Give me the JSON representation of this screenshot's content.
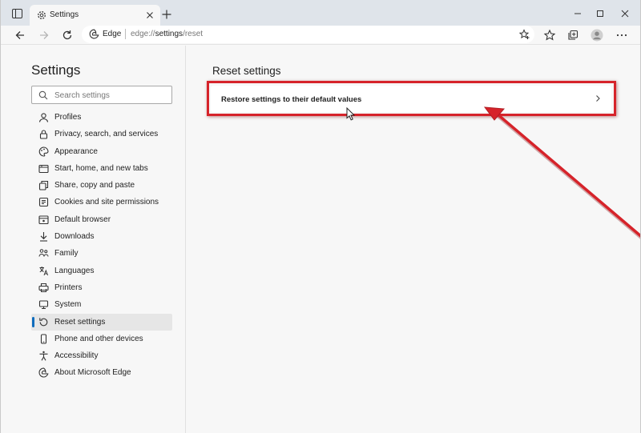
{
  "tab": {
    "title": "Settings"
  },
  "toolbar": {
    "site_label": "Edge",
    "url_prefix": "edge://",
    "url_host": "settings",
    "url_path": "/reset"
  },
  "sidebar": {
    "heading": "Settings",
    "search_placeholder": "Search settings",
    "items": [
      {
        "label": "Profiles",
        "icon": "profile-icon"
      },
      {
        "label": "Privacy, search, and services",
        "icon": "lock-icon"
      },
      {
        "label": "Appearance",
        "icon": "appearance-icon"
      },
      {
        "label": "Start, home, and new tabs",
        "icon": "home-tabs-icon"
      },
      {
        "label": "Share, copy and paste",
        "icon": "share-icon"
      },
      {
        "label": "Cookies and site permissions",
        "icon": "cookies-icon"
      },
      {
        "label": "Default browser",
        "icon": "browser-icon"
      },
      {
        "label": "Downloads",
        "icon": "download-icon"
      },
      {
        "label": "Family",
        "icon": "family-icon"
      },
      {
        "label": "Languages",
        "icon": "languages-icon"
      },
      {
        "label": "Printers",
        "icon": "printer-icon"
      },
      {
        "label": "System",
        "icon": "system-icon"
      },
      {
        "label": "Reset settings",
        "icon": "reset-icon",
        "active": true
      },
      {
        "label": "Phone and other devices",
        "icon": "phone-icon"
      },
      {
        "label": "Accessibility",
        "icon": "accessibility-icon"
      },
      {
        "label": "About Microsoft Edge",
        "icon": "edge-logo-icon"
      }
    ]
  },
  "main": {
    "heading": "Reset settings",
    "restore_label": "Restore settings to their default values"
  },
  "colors": {
    "accent": "#0f6cbd",
    "annotation_red": "#d6232a"
  }
}
